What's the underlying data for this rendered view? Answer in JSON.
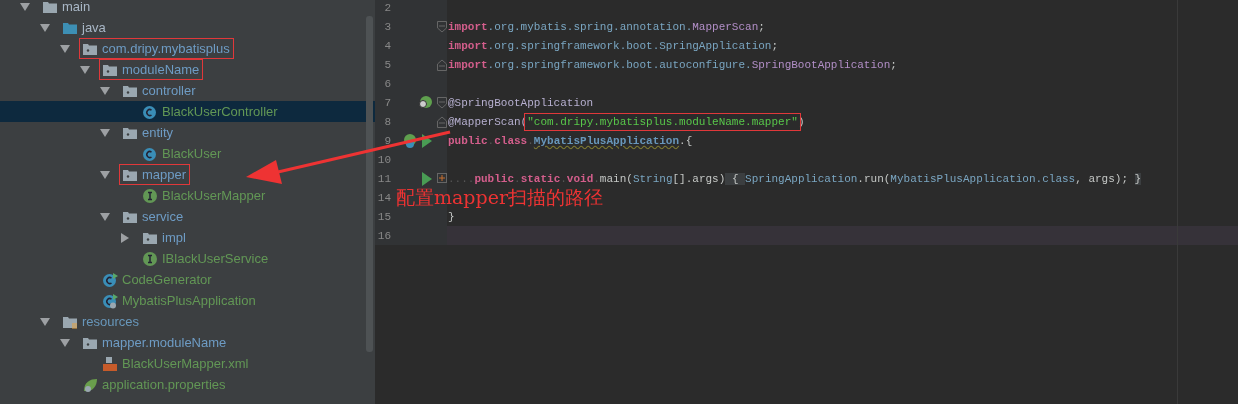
{
  "project_tree": [
    {
      "label": "main",
      "kind": "folder",
      "expanded": true,
      "children": [
        {
          "label": "java",
          "kind": "source-folder",
          "expanded": true,
          "children": [
            {
              "label": "com.dripy.mybatisplus",
              "kind": "package",
              "expanded": true,
              "boxed": true,
              "children": [
                {
                  "label": "moduleName",
                  "kind": "package",
                  "expanded": true,
                  "boxed": true,
                  "children": [
                    {
                      "label": "controller",
                      "kind": "package",
                      "expanded": true,
                      "children": [
                        {
                          "label": "BlackUserController",
                          "kind": "class",
                          "selected": true
                        }
                      ]
                    },
                    {
                      "label": "entity",
                      "kind": "package",
                      "expanded": true,
                      "children": [
                        {
                          "label": "BlackUser",
                          "kind": "class",
                          "selected": false
                        }
                      ]
                    },
                    {
                      "label": "mapper",
                      "kind": "package",
                      "expanded": true,
                      "boxed": true,
                      "children": [
                        {
                          "label": "BlackUserMapper",
                          "kind": "interface",
                          "selected": false
                        }
                      ]
                    },
                    {
                      "label": "service",
                      "kind": "package",
                      "expanded": true,
                      "children": [
                        {
                          "label": "impl",
                          "kind": "package",
                          "expanded": false
                        },
                        {
                          "label": "IBlackUserService",
                          "kind": "interface",
                          "selected": false
                        }
                      ]
                    }
                  ]
                },
                {
                  "label": "CodeGenerator",
                  "kind": "runnable-class",
                  "selected": false
                },
                {
                  "label": "MybatisPlusApplication",
                  "kind": "spring-class",
                  "selected": false
                }
              ]
            }
          ]
        },
        {
          "label": "resources",
          "kind": "resources-folder",
          "expanded": true,
          "children": [
            {
              "label": "mapper.moduleName",
              "kind": "package",
              "expanded": true,
              "children": [
                {
                  "label": "BlackUserMapper.xml",
                  "kind": "xml",
                  "selected": false
                }
              ]
            },
            {
              "label": "application.properties",
              "kind": "properties",
              "selected": false
            }
          ]
        }
      ]
    }
  ],
  "code_lines": [
    {
      "number": "2"
    },
    {
      "number": "3",
      "fold": {
        "kind": "open"
      },
      "tokens": [
        {
          "text": "import",
          "kind": "keyword"
        },
        {
          "text": ".org.mybatis.spring.annotation.",
          "kind": "package"
        },
        {
          "text": "MapperScan",
          "kind": "type"
        },
        {
          "text": ";",
          "kind": "plain"
        }
      ]
    },
    {
      "number": "4",
      "tokens": [
        {
          "text": "import",
          "kind": "keyword"
        },
        {
          "text": ".org.springframework.boot.",
          "kind": "package"
        },
        {
          "text": "SpringApplication",
          "kind": "package"
        },
        {
          "text": ";",
          "kind": "plain"
        }
      ]
    },
    {
      "number": "5",
      "fold": {
        "kind": "close"
      },
      "tokens": [
        {
          "text": "import",
          "kind": "keyword"
        },
        {
          "text": ".org.springframework.boot.autoconfigure.",
          "kind": "package"
        },
        {
          "text": "SpringBootApplication",
          "kind": "type"
        },
        {
          "text": ";",
          "kind": "plain"
        }
      ]
    },
    {
      "number": "6"
    },
    {
      "number": "7",
      "gutter_icons": [
        {
          "kind": "spring-search"
        }
      ],
      "fold": {
        "kind": "open"
      },
      "tokens": [
        {
          "text": "@SpringBootApplication",
          "kind": "annotation"
        }
      ]
    },
    {
      "number": "8",
      "fold": {
        "kind": "close"
      },
      "tokens": [
        {
          "text": "@MapperScan(",
          "kind": "annotation"
        },
        {
          "text": "\"com.dripy.mybatisplus.moduleName.mapper\"",
          "kind": "string",
          "boxed": true
        },
        {
          "text": ")",
          "kind": "plain"
        }
      ]
    },
    {
      "number": "9",
      "gutter_icons": [
        {
          "kind": "spring-bean"
        },
        {
          "kind": "run"
        }
      ],
      "tokens": [
        {
          "text": "public",
          "kind": "keyword"
        },
        {
          "text": ".",
          "kind": "dot"
        },
        {
          "text": "class",
          "kind": "keyword"
        },
        {
          "text": ".",
          "kind": "dot"
        },
        {
          "text": "MybatisPlusApplication",
          "kind": "classname"
        },
        {
          "text": ".{",
          "kind": "plain"
        }
      ]
    },
    {
      "number": "10"
    },
    {
      "number": "11",
      "gutter_icons": [
        {
          "kind": "run"
        }
      ],
      "fold": {
        "kind": "folded"
      },
      "tokens": [
        {
          "text": "....",
          "kind": "dot"
        },
        {
          "text": "public",
          "kind": "keyword"
        },
        {
          "text": ".",
          "kind": "dot"
        },
        {
          "text": "static",
          "kind": "keyword"
        },
        {
          "text": ".",
          "kind": "dot"
        },
        {
          "text": "void",
          "kind": "keyword"
        },
        {
          "text": ".",
          "kind": "dot"
        },
        {
          "text": "main(",
          "kind": "plain"
        },
        {
          "text": "String",
          "kind": "package"
        },
        {
          "text": "[].args)",
          "kind": "plain"
        },
        {
          "text": " { ",
          "kind": "folded"
        },
        {
          "text": "SpringApplication",
          "kind": "package"
        },
        {
          "text": ".run(",
          "kind": "plain"
        },
        {
          "text": "MybatisPlusApplication",
          "kind": "package"
        },
        {
          "text": ".class",
          "kind": "package"
        },
        {
          "text": ", args); ",
          "kind": "plain"
        },
        {
          "text": "}",
          "kind": "folded"
        }
      ]
    },
    {
      "number": "14"
    },
    {
      "number": "15",
      "tokens": [
        {
          "text": "}",
          "kind": "plain"
        }
      ]
    },
    {
      "number": "16",
      "current": true
    }
  ],
  "annotation": {
    "text": "配置mapper扫描的路径"
  }
}
